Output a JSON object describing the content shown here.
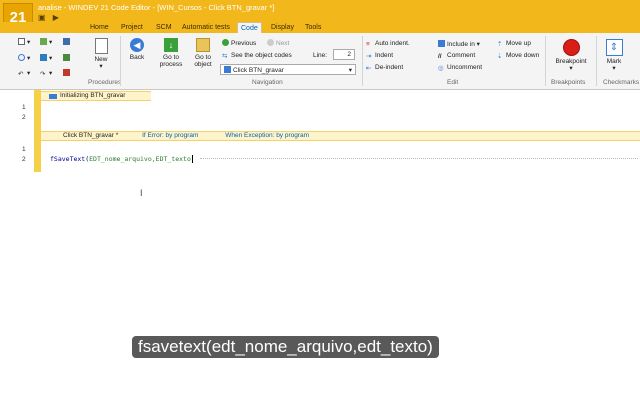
{
  "window": {
    "logo": "21",
    "title": "analise - WINDEV 21  Code Editor - [WIN_Cursos - Click BTN_gravar *]"
  },
  "tabs": [
    "Home",
    "Project",
    "SCM",
    "Automatic tests",
    "Code",
    "Display",
    "Tools"
  ],
  "ribbon": {
    "procedures": {
      "new": "New",
      "label": "Procedures"
    },
    "navigation": {
      "back": "Back",
      "goto_process": "Go to\nprocess",
      "goto_object": "Go to\nobject",
      "previous": "Previous",
      "next": "Next",
      "see_codes": "See the object codes",
      "line_label": "Line:",
      "line_value": "2",
      "current_select": "Click BTN_gravar",
      "label": "Navigation"
    },
    "edit": {
      "auto_indent": "Auto indent.",
      "indent": "Indent",
      "deindent": "De-indent",
      "include_in": "Include in",
      "comment": "Comment",
      "uncomment": "Uncomment",
      "move_up": "Move up",
      "move_down": "Move down",
      "label": "Edit"
    },
    "breakpoints": {
      "breakpoint": "Breakpoint",
      "label": "Breakpoints"
    },
    "checkmarks": {
      "mark": "Mark",
      "label": "Checkmarks"
    }
  },
  "editor": {
    "section1": {
      "title": "Initializing BTN_gravar",
      "lines": [
        "1",
        "2"
      ]
    },
    "section2": {
      "title": "Click BTN_gravar *",
      "if_error": "If Error: by program",
      "when_exception": "When Exception: by program",
      "lines": [
        "1",
        "2"
      ],
      "code_func": "fSaveText(",
      "code_args": "EDT_nome_arquivo,EDT_texto"
    }
  },
  "subtitle": "fsavetext(edt_nome_arquivo,edt_texto)",
  "colors": {
    "accent": "#f2b81b",
    "link": "#0063b1"
  }
}
